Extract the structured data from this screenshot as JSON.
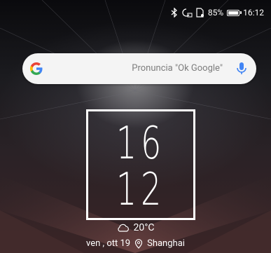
{
  "status_bar": {
    "battery_percent_text": "85%",
    "battery_level": 0.85,
    "time": "16:12",
    "icons": [
      "bluetooth-icon",
      "alarm-icon",
      "sim-icon",
      "battery-icon"
    ]
  },
  "search": {
    "placeholder": "Pronuncia \"Ok Google\"",
    "logo": "google-g-icon",
    "mic": "microphone-icon"
  },
  "clock": {
    "hour": "16",
    "minute": "12"
  },
  "weather": {
    "icon": "cloud-sun-icon",
    "temperature": "20°C"
  },
  "date": {
    "text": "ven , ott 19",
    "location_icon": "location-pin-icon",
    "city": "Shanghai"
  }
}
